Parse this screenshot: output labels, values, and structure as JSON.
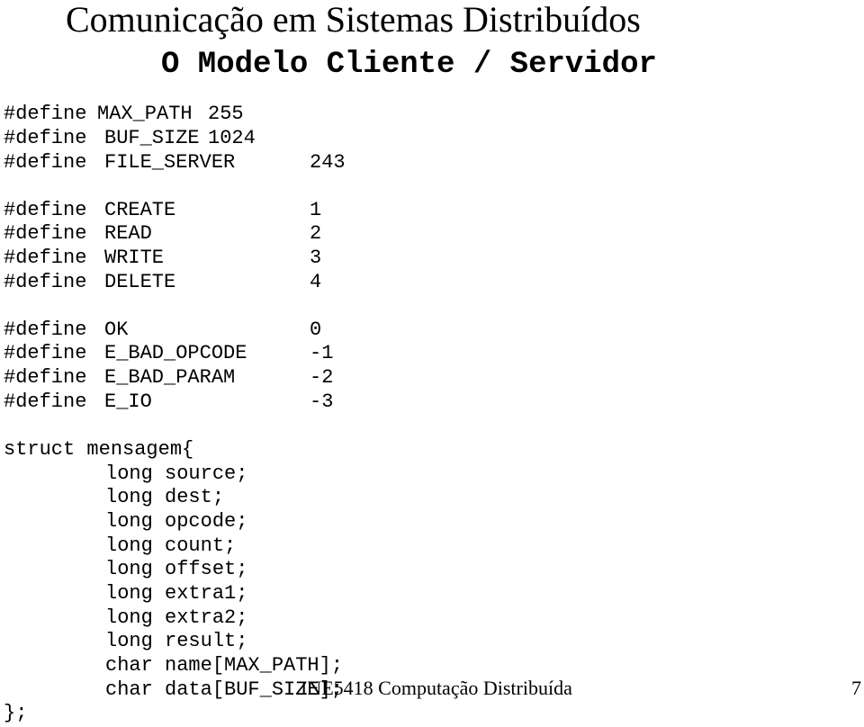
{
  "slide": {
    "title": "Comunicação em Sistemas Distribuídos",
    "subtitle": "O Modelo Cliente / Servidor",
    "footer": "INE5418 Computação Distribuída",
    "page_number": "7"
  },
  "defines_sizes": [
    {
      "keyword": "#define",
      "name": "MAX_PATH",
      "value": "255"
    },
    {
      "keyword": "#define",
      "name": "BUF_SIZE",
      "value": "1024"
    },
    {
      "keyword": "#define",
      "name": "FILE_SERVER",
      "value": "243"
    }
  ],
  "defines_ops": [
    {
      "keyword": "#define",
      "name": "CREATE",
      "value": "1"
    },
    {
      "keyword": "#define",
      "name": "READ",
      "value": "2"
    },
    {
      "keyword": "#define",
      "name": "WRITE",
      "value": "3"
    },
    {
      "keyword": "#define",
      "name": "DELETE",
      "value": "4"
    }
  ],
  "defines_errors": [
    {
      "keyword": "#define",
      "name": "OK",
      "value": "0"
    },
    {
      "keyword": "#define",
      "name": "E_BAD_OPCODE",
      "value": "-1"
    },
    {
      "keyword": "#define",
      "name": "E_BAD_PARAM",
      "value": "-2"
    },
    {
      "keyword": "#define",
      "name": "E_IO",
      "value": "-3"
    }
  ],
  "struct": {
    "open": "struct mensagem{",
    "fields": [
      "long source;",
      "long dest;",
      "long opcode;",
      "long count;",
      "long offset;",
      "long extra1;",
      "long extra2;",
      "long result;",
      "char name[MAX_PATH];",
      "char data[BUF_SIZE];"
    ],
    "close": "};"
  }
}
